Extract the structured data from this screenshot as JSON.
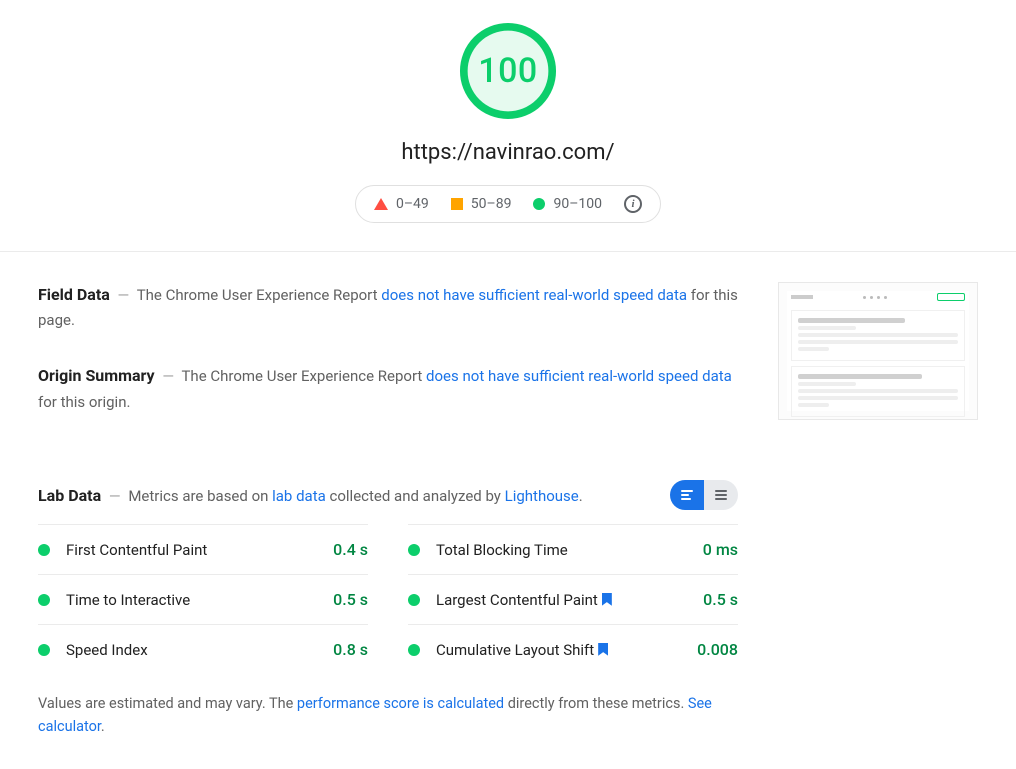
{
  "gauge": {
    "score": "100"
  },
  "url": "https://navinrao.com/",
  "legend": {
    "fail": "0–49",
    "avg": "50–89",
    "pass": "90–100"
  },
  "field_data": {
    "title": "Field Data",
    "prefix": "The Chrome User Experience Report ",
    "link": "does not have sufficient real-world speed data",
    "suffix": " for this page."
  },
  "origin_summary": {
    "title": "Origin Summary",
    "prefix": "The Chrome User Experience Report ",
    "link": "does not have sufficient real-world speed data",
    "suffix": " for this origin."
  },
  "lab": {
    "title": "Lab Data",
    "prefix": "Metrics are based on ",
    "link1": "lab data",
    "middle": " collected and analyzed by ",
    "link2": "Lighthouse",
    "suffix": "."
  },
  "metrics": {
    "left": [
      {
        "name": "First Contentful Paint",
        "value": "0.4 s",
        "bookmark": false
      },
      {
        "name": "Time to Interactive",
        "value": "0.5 s",
        "bookmark": false
      },
      {
        "name": "Speed Index",
        "value": "0.8 s",
        "bookmark": false
      }
    ],
    "right": [
      {
        "name": "Total Blocking Time",
        "value": "0 ms",
        "bookmark": false
      },
      {
        "name": "Largest Contentful Paint",
        "value": "0.5 s",
        "bookmark": true
      },
      {
        "name": "Cumulative Layout Shift",
        "value": "0.008",
        "bookmark": true
      }
    ]
  },
  "footnote": {
    "prefix": "Values are estimated and may vary. The ",
    "link1": "performance score is calculated",
    "middle": " directly from these metrics. ",
    "link2": "See calculator",
    "suffix": "."
  }
}
